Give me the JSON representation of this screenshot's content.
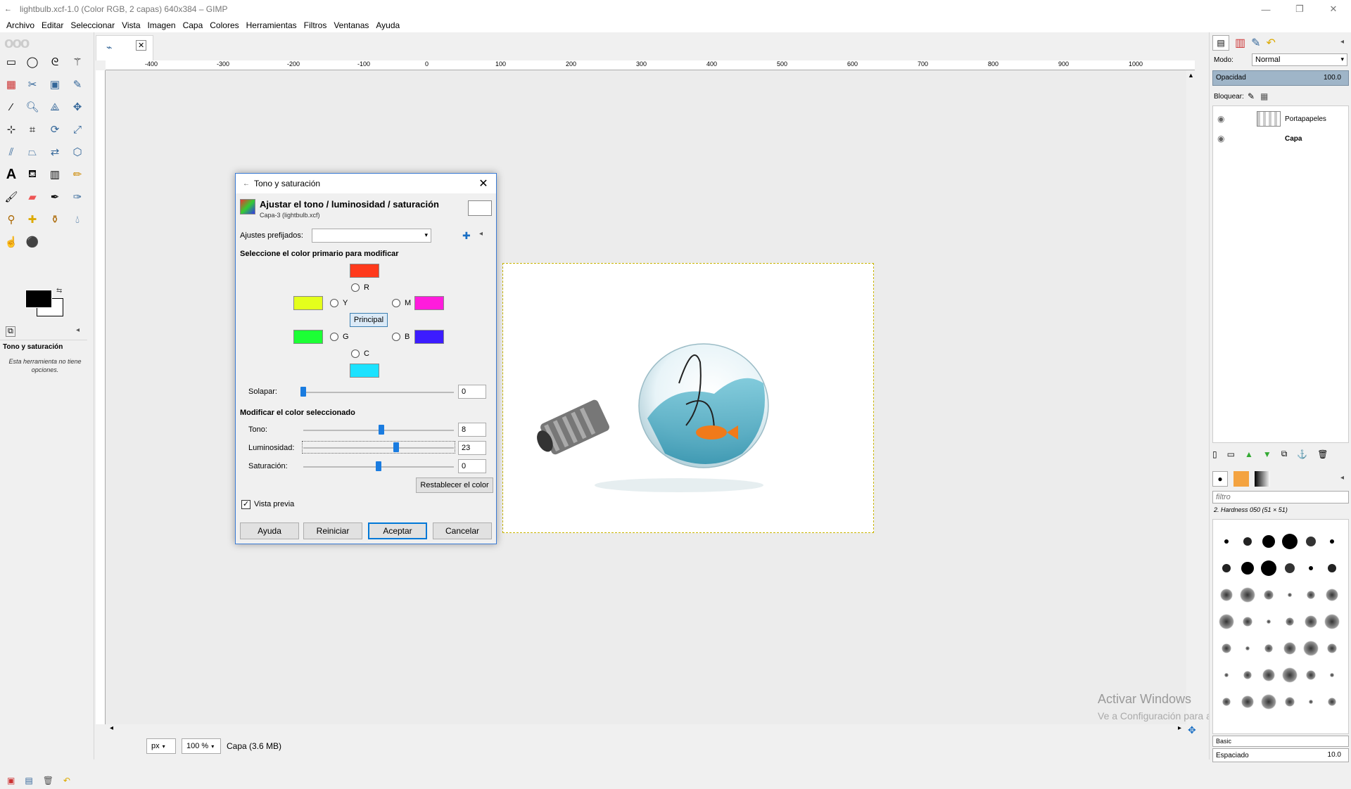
{
  "window": {
    "title": "lightbulb.xcf-1.0 (Color RGB, 2 capas) 640x384 – GIMP",
    "minimize": "—",
    "maximize": "❐",
    "close": "✕"
  },
  "menu": [
    "Archivo",
    "Editar",
    "Seleccionar",
    "Vista",
    "Imagen",
    "Capa",
    "Colores",
    "Herramientas",
    "Filtros",
    "Ventanas",
    "Ayuda"
  ],
  "tool_options": {
    "title": "Tono y saturación",
    "note": "Esta herramienta no tiene opciones."
  },
  "ruler": [
    "-400",
    "-300",
    "-200",
    "-100",
    "0",
    "100",
    "200",
    "300",
    "400",
    "500",
    "600",
    "700",
    "800",
    "900",
    "1000"
  ],
  "status": {
    "unit": "px",
    "zoom": "100 %",
    "info": "Capa (3.6 MB)"
  },
  "watermark": {
    "line1": "Activar Windows",
    "line2": "Ve a Configuración para activar Windows."
  },
  "layers_panel": {
    "mode_label": "Modo:",
    "mode_value": "Normal",
    "opacity_label": "Opacidad",
    "opacity_value": "100.0",
    "lock_label": "Bloquear:",
    "layers": [
      {
        "name": "Portapapeles",
        "bold": false
      },
      {
        "name": "Capa",
        "bold": true
      }
    ]
  },
  "brushes_panel": {
    "filter_placeholder": "filtro",
    "current": "2. Hardness 050 (51 × 51)",
    "set": "Basic",
    "spacing_label": "Espaciado",
    "spacing_value": "10.0"
  },
  "dialog": {
    "title": "Tono y saturación",
    "heading": "Ajustar el tono / luminosidad / saturación",
    "subheading": "Capa-3 (lightbulb.xcf)",
    "presets_label": "Ajustes prefijados:",
    "select_primary_label": "Seleccione el color primario para modificar",
    "primaries": {
      "R": "R",
      "Y": "Y",
      "M": "M",
      "G": "G",
      "B": "B",
      "C": "C"
    },
    "colors": {
      "R": "#ff3a1c",
      "Y": "#e4ff1c",
      "M": "#ff1cdc",
      "G": "#1cff35",
      "B": "#3c1cff",
      "C": "#1ce2ff"
    },
    "master_button": "Principal",
    "overlap_label": "Solapar:",
    "overlap_value": "0",
    "overlap_fraction": 0.0,
    "modify_label": "Modificar el color seleccionado",
    "hue_label": "Tono:",
    "hue_value": "8",
    "hue_fraction": 0.52,
    "lightness_label": "Luminosidad:",
    "lightness_value": "23",
    "lightness_fraction": 0.615,
    "saturation_label": "Saturación:",
    "saturation_value": "0",
    "saturation_fraction": 0.5,
    "reset_color_button": "Restablecer el color",
    "preview_label": "Vista previa",
    "preview_checked": "✓",
    "buttons": {
      "help": "Ayuda",
      "reset": "Reiniciar",
      "ok": "Aceptar",
      "cancel": "Cancelar"
    }
  }
}
